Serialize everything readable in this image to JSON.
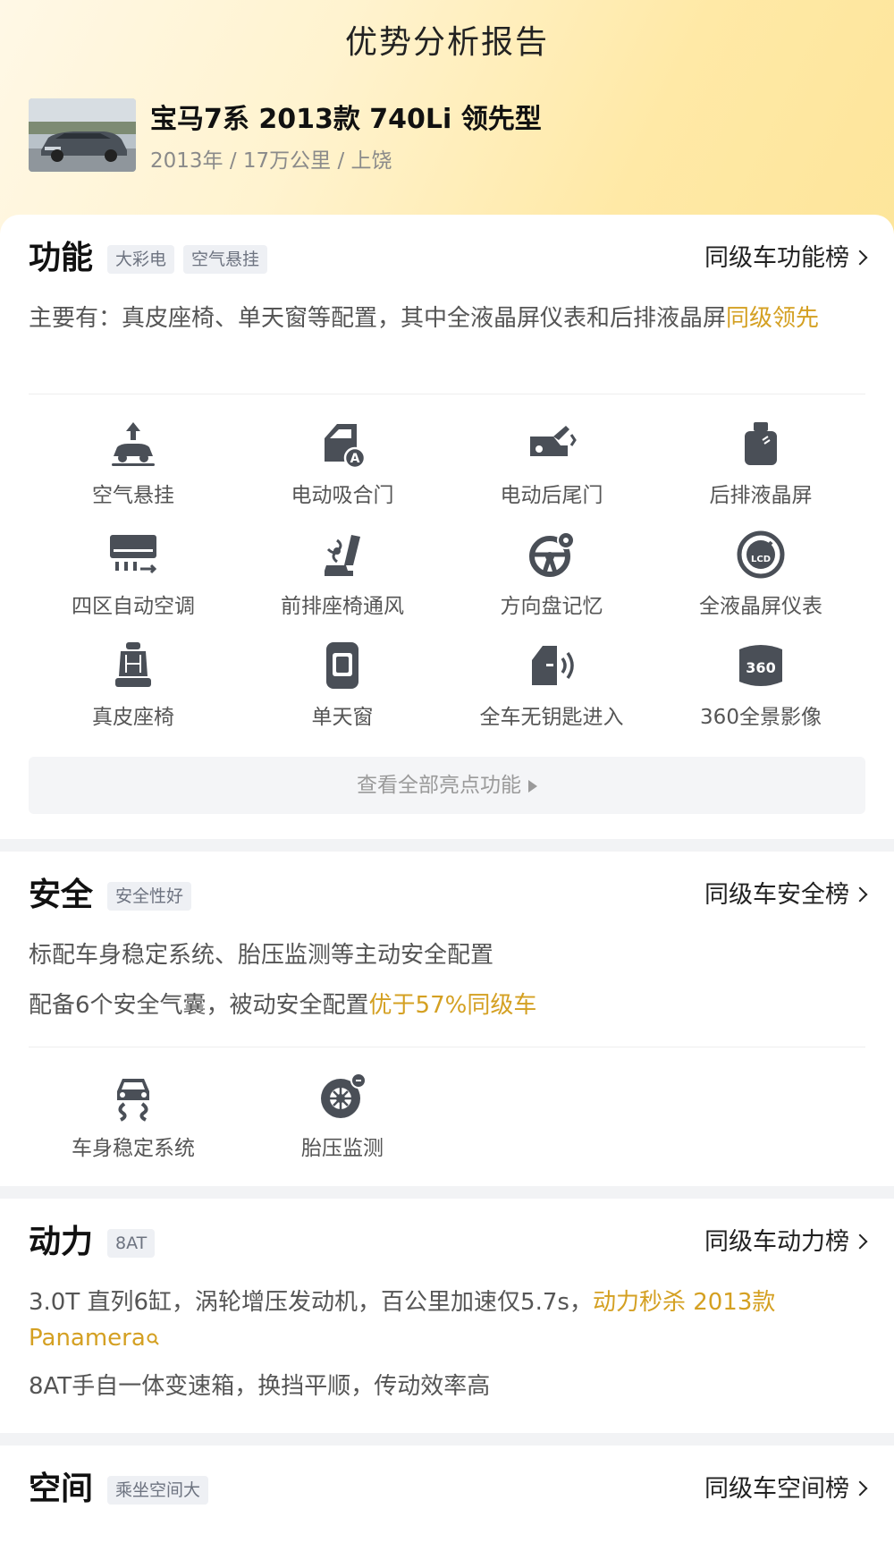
{
  "header": {
    "title": "优势分析报告",
    "car_name": "宝马7系 2013款 740Li 领先型",
    "car_meta": "2013年 / 17万公里 / 上饶"
  },
  "features_section": {
    "title": "功能",
    "tags": [
      "大彩电",
      "空气悬挂"
    ],
    "link_label": "同级车功能榜",
    "desc_prefix": "主要有：真皮座椅、单天窗等配置，其中全液晶屏仪表和后排液晶屏",
    "desc_highlight": "同级领先",
    "items": [
      {
        "label": "空气悬挂",
        "icon": "air-suspension-icon"
      },
      {
        "label": "电动吸合门",
        "icon": "soft-close-door-icon"
      },
      {
        "label": "电动后尾门",
        "icon": "power-tailgate-icon"
      },
      {
        "label": "后排液晶屏",
        "icon": "rear-screen-icon"
      },
      {
        "label": "四区自动空调",
        "icon": "air-conditioner-icon"
      },
      {
        "label": "前排座椅通风",
        "icon": "seat-ventilation-icon"
      },
      {
        "label": "方向盘记忆",
        "icon": "steering-memory-icon"
      },
      {
        "label": "全液晶屏仪表",
        "icon": "lcd-gauge-icon"
      },
      {
        "label": "真皮座椅",
        "icon": "leather-seat-icon"
      },
      {
        "label": "单天窗",
        "icon": "sunroof-icon"
      },
      {
        "label": "全车无钥匙进入",
        "icon": "keyless-entry-icon"
      },
      {
        "label": "360全景影像",
        "icon": "camera-360-icon"
      }
    ],
    "view_all_label": "查看全部亮点功能"
  },
  "safety_section": {
    "title": "安全",
    "tags": [
      "安全性好"
    ],
    "link_label": "同级车安全榜",
    "line1": "标配车身稳定系统、胎压监测等主动安全配置",
    "line2_prefix": "配备6个安全气囊，被动安全配置",
    "line2_highlight": "优于57%同级车",
    "items": [
      {
        "label": "车身稳定系统",
        "icon": "stability-control-icon"
      },
      {
        "label": "胎压监测",
        "icon": "tire-pressure-icon"
      }
    ]
  },
  "power_section": {
    "title": "动力",
    "tags": [
      "8AT"
    ],
    "link_label": "同级车动力榜",
    "line1_prefix": "3.0T 直列6缸，涡轮增压发动机，百公里加速仅5.7s，",
    "line1_highlight_a": "动力秒杀 2013款",
    "line1_highlight_b": "Panamera",
    "line2": "8AT手自一体变速箱，换挡平顺，传动效率高"
  },
  "space_section": {
    "title": "空间",
    "tags": [
      "乘坐空间大"
    ],
    "link_label": "同级车空间榜"
  }
}
